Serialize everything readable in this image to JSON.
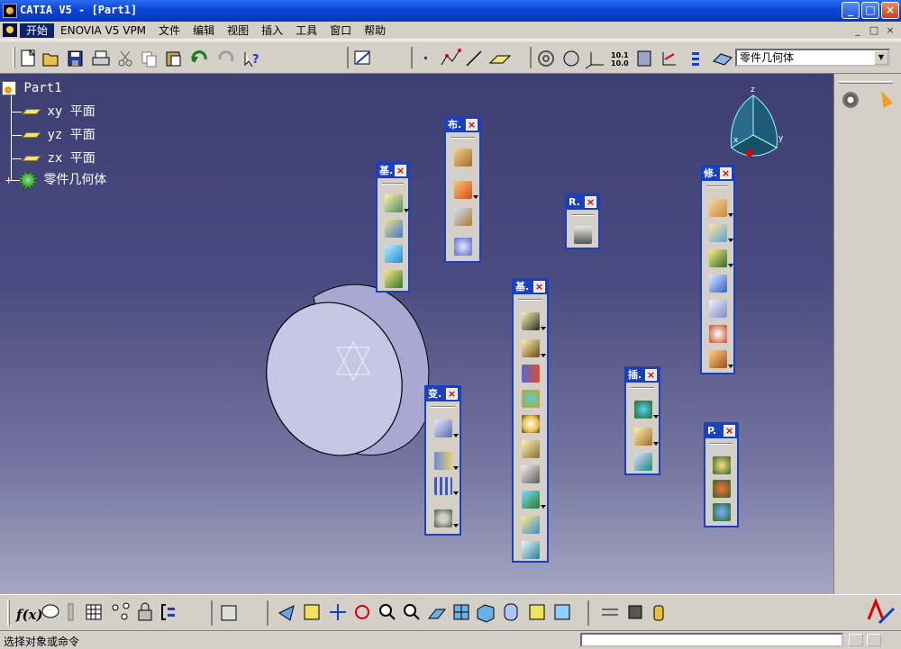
{
  "window": {
    "title": "CATIA V5 - [Part1]",
    "controls": {
      "minimize": "_",
      "maximize": "□",
      "close": "×"
    }
  },
  "menubar": {
    "items": [
      "开始",
      "ENOVIA V5 VPM",
      "文件",
      "编辑",
      "视图",
      "插入",
      "工具",
      "窗口",
      "帮助"
    ],
    "active": "开始",
    "doc_controls": [
      "_",
      "□",
      "×"
    ]
  },
  "toolbar": {
    "workbench_combo": {
      "value": "零件几何体"
    }
  },
  "tree": {
    "root": "Part1",
    "items": [
      {
        "label": "xy 平面",
        "icon": "plane-icon"
      },
      {
        "label": "yz 平面",
        "icon": "plane-icon"
      },
      {
        "label": "zx 平面",
        "icon": "plane-icon"
      },
      {
        "label": "零件几何体",
        "icon": "gear-body-icon"
      }
    ]
  },
  "floating_toolbars": [
    {
      "id": "bu",
      "caption": "布."
    },
    {
      "id": "ji1",
      "caption": "基."
    },
    {
      "id": "r",
      "caption": "R."
    },
    {
      "id": "xiu",
      "caption": "修."
    },
    {
      "id": "ji2",
      "caption": "基."
    },
    {
      "id": "bian",
      "caption": "变."
    },
    {
      "id": "cha",
      "caption": "插."
    },
    {
      "id": "p",
      "caption": "P."
    }
  ],
  "compass": {
    "axis_x": "x",
    "axis_y": "y",
    "axis_z": "z"
  },
  "status": {
    "prompt": "选择对象或命令"
  },
  "colors": {
    "titlebar": "#0a45d9",
    "toolbar_caption": "#1a3fbf",
    "viewport_top": "#3d3e72",
    "viewport_bottom": "#a6a7c3"
  }
}
